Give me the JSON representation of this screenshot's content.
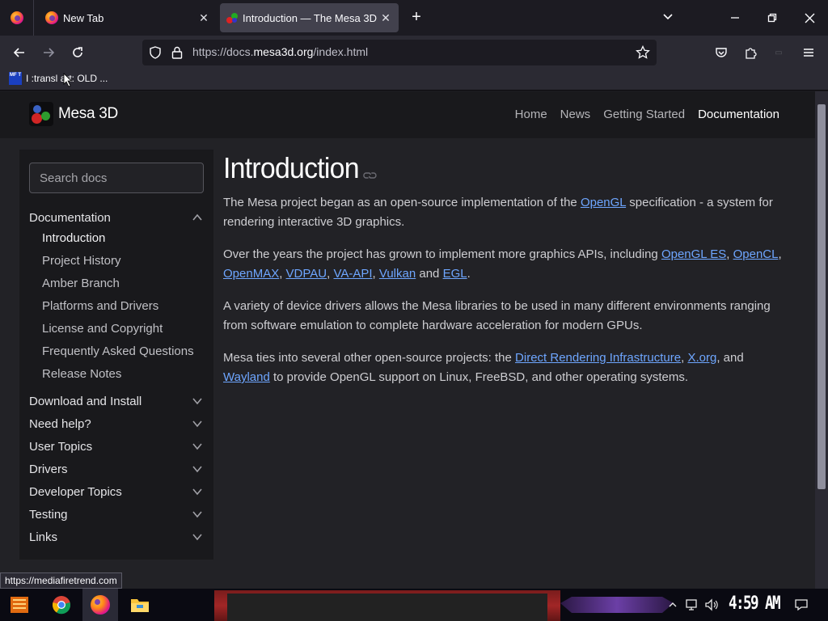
{
  "browser": {
    "tabs": [
      {
        "title": "New Tab",
        "active": false
      },
      {
        "title": "Introduction — The Mesa 3D",
        "active": true
      }
    ],
    "url": {
      "prefix": "https://docs.",
      "domain": "mesa3d.org",
      "path": "/index.html"
    },
    "bookmark": {
      "icon_text": "MF T",
      "label": "I :transl art: OLD ..."
    },
    "status_link": "https://mediafiretrend.com"
  },
  "site": {
    "brand": "Mesa 3D",
    "nav": [
      {
        "label": "Home",
        "current": false
      },
      {
        "label": "News",
        "current": false
      },
      {
        "label": "Getting Started",
        "current": false
      },
      {
        "label": "Documentation",
        "current": true
      }
    ]
  },
  "sidebar": {
    "search_placeholder": "Search docs",
    "sections": [
      {
        "label": "Documentation",
        "expanded": true
      },
      {
        "label": "Download and Install",
        "expanded": false
      },
      {
        "label": "Need help?",
        "expanded": false
      },
      {
        "label": "User Topics",
        "expanded": false
      },
      {
        "label": "Drivers",
        "expanded": false
      },
      {
        "label": "Developer Topics",
        "expanded": false
      },
      {
        "label": "Testing",
        "expanded": false
      },
      {
        "label": "Links",
        "expanded": false
      }
    ],
    "doc_items": [
      {
        "label": "Introduction",
        "active": true
      },
      {
        "label": "Project History",
        "active": false
      },
      {
        "label": "Amber Branch",
        "active": false
      },
      {
        "label": "Platforms and Drivers",
        "active": false
      },
      {
        "label": "License and Copyright",
        "active": false
      },
      {
        "label": "Frequently Asked Questions",
        "active": false
      },
      {
        "label": "Release Notes",
        "active": false
      }
    ]
  },
  "content": {
    "title": "Introduction",
    "p1": {
      "t1": "The Mesa project began as an open-source implementation of the ",
      "l1": "OpenGL",
      "t2": " specification - a system for rendering interactive 3D graphics."
    },
    "p2": {
      "t1": "Over the years the project has grown to implement more graphics APIs, including ",
      "l1": "OpenGL ES",
      "s1": ", ",
      "l2": "OpenCL",
      "s2": ", ",
      "l3": "OpenMAX",
      "s3": ", ",
      "l4": "VDPAU",
      "s4": ", ",
      "l5": "VA-API",
      "s5": ", ",
      "l6": "Vulkan",
      "s6": " and ",
      "l7": "EGL",
      "s7": "."
    },
    "p3": "A variety of device drivers allows the Mesa libraries to be used in many different environments ranging from software emulation to complete hardware acceleration for modern GPUs.",
    "p4": {
      "t1": "Mesa ties into several other open-source projects: the ",
      "l1": "Direct Rendering Infrastructure",
      "s1": ", ",
      "l2": "X.org",
      "s2": ", and ",
      "l3": "Wayland",
      "t2": " to provide OpenGL support on Linux, FreeBSD, and other operating systems."
    }
  },
  "taskbar": {
    "clock": "4:59 AM"
  },
  "colors": {
    "link": "#6ea6ff",
    "page_bg": "#222226",
    "sidebar_bg": "#19191c",
    "active_tab": "#42414d"
  }
}
